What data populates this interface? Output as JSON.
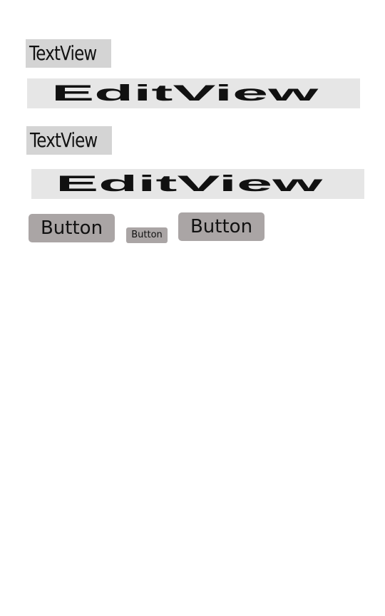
{
  "colors": {
    "background": "#ffffff",
    "textview_background": "#d4d4d4",
    "editview_background": "#e6e6e6",
    "button_background": "#aaa5a5",
    "text": "#111111"
  },
  "layout_items": {
    "textview_1": "TextView",
    "editview_1": "EditView",
    "textview_2": "TextView",
    "editview_2": "EditView"
  },
  "buttons": {
    "large_left": "Button",
    "small_middle": "Button",
    "large_right": "Button"
  }
}
